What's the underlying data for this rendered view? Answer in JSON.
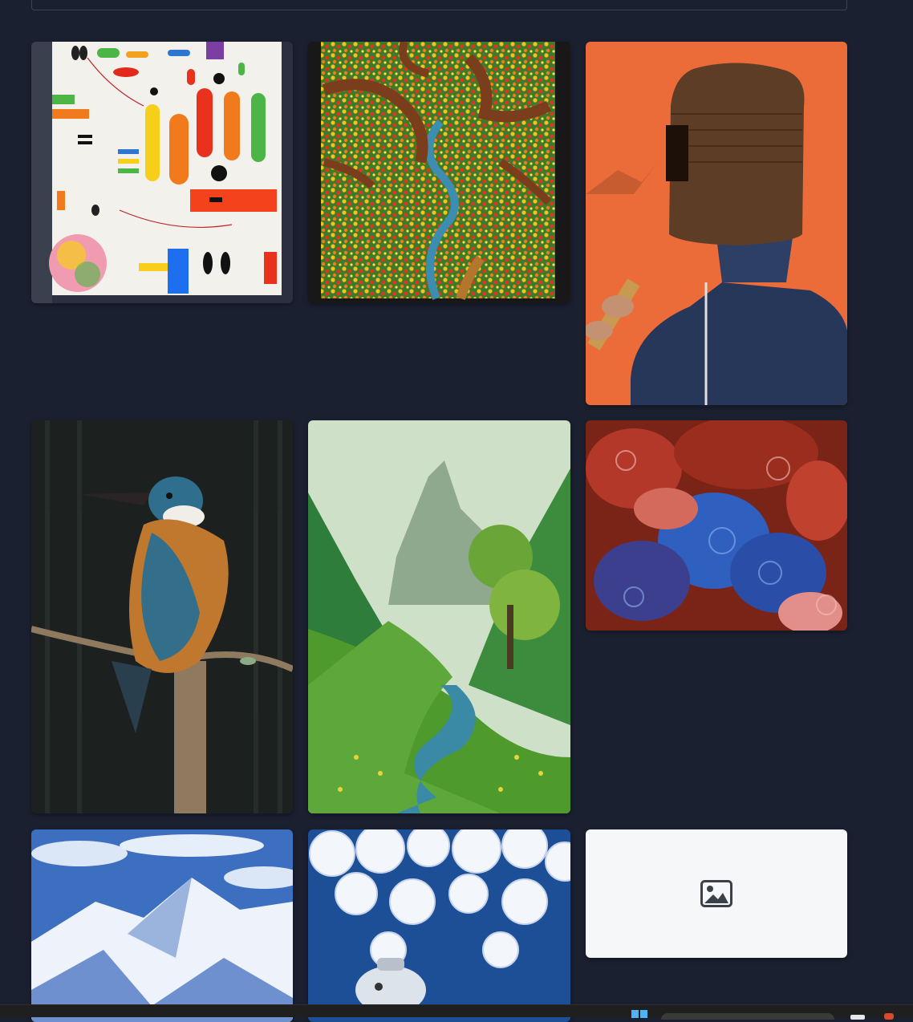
{
  "gallery": {
    "artworks": [
      {
        "name": "abstract-color-shapes-painting"
      },
      {
        "name": "flower-forest-path-painting"
      },
      {
        "name": "basket-hat-flute-player-painting"
      },
      {
        "name": "kingfisher-on-branch-painting"
      },
      {
        "name": "green-mountain-valley-river-painting"
      },
      {
        "name": "red-blue-swirl-abstract-painting"
      },
      {
        "name": "snowy-mountains-blue-sky-painting"
      },
      {
        "name": "white-swirl-clouds-teapot-painting"
      },
      {
        "name": "missing-image-placeholder"
      }
    ]
  },
  "colors": {
    "background": "#1b2030",
    "placeholder": "#f6f7f9",
    "placeholder_icon": "#3c4048"
  },
  "taskbar": {
    "icons": [
      "windows-start-icon",
      "search-bar",
      "app-icon",
      "app-icon"
    ]
  }
}
